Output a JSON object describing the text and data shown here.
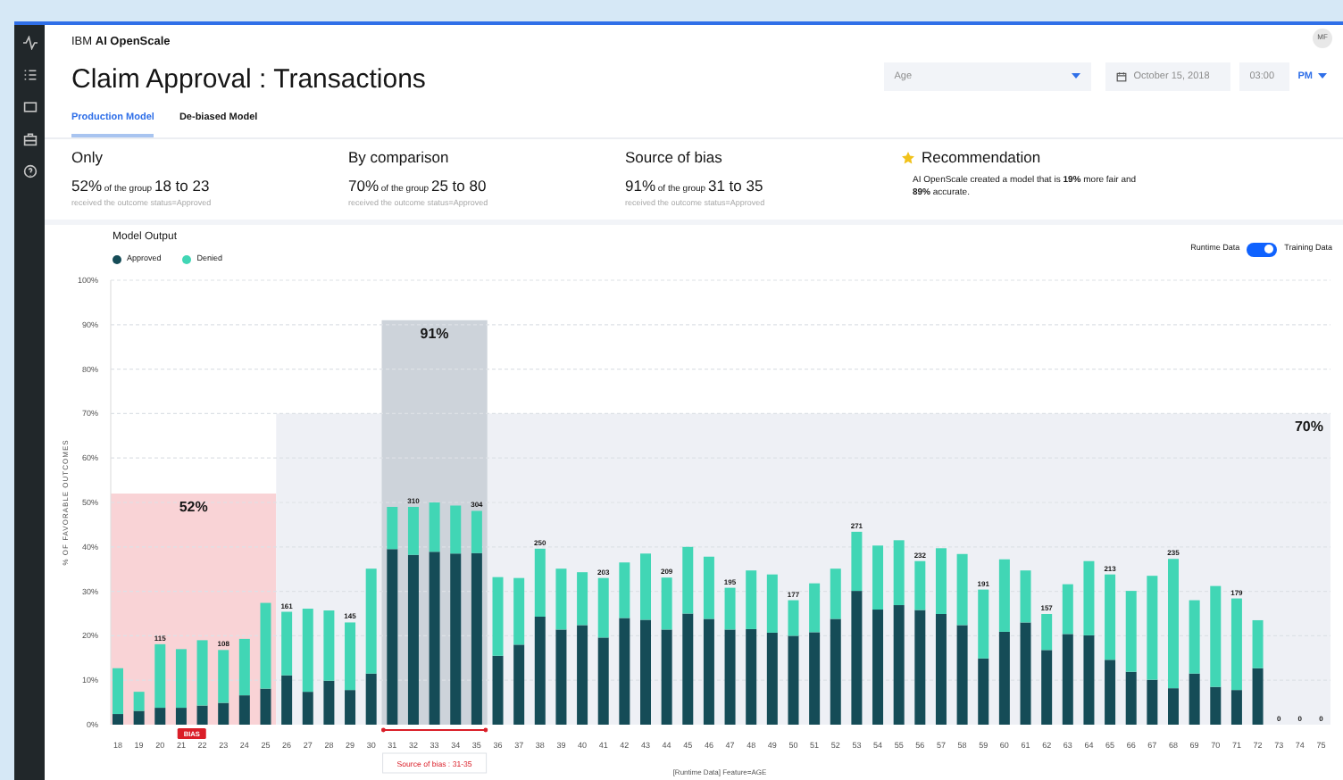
{
  "header": {
    "brand_prefix": "IBM",
    "brand_name": "AI OpenScale",
    "avatar": "MF"
  },
  "page_title": "Claim Approval : Transactions",
  "tabs": [
    {
      "label": "Production Model",
      "selected": true
    },
    {
      "label": "De-biased Model",
      "selected": false
    }
  ],
  "filters": {
    "feature": {
      "value": "Age"
    },
    "date": {
      "value": "October 15, 2018"
    },
    "time": {
      "value": "03:00"
    },
    "period": {
      "value": "PM"
    }
  },
  "summary": [
    {
      "kind": "stat",
      "title": "Only",
      "percent": "52%",
      "connector": "of the group",
      "range": "18 to 23",
      "note": "received the outcome status=Approved"
    },
    {
      "kind": "stat",
      "title": "By comparison",
      "percent": "70%",
      "connector": "of the group",
      "range": "25 to 80",
      "note": "received the outcome status=Approved"
    },
    {
      "kind": "stat",
      "title": "Source of bias",
      "percent": "91%",
      "connector": "of the group",
      "range": "31 to 35",
      "note": "received the outcome status=Approved"
    },
    {
      "kind": "recommendation",
      "title": "Recommendation",
      "text": "AI OpenScale created a model that is **19%** more fair and **89%** accurate."
    }
  ],
  "chart": {
    "title": "Model Output",
    "toggle": {
      "left_label": "Runtime Data",
      "right_label": "Training Data",
      "on": true
    },
    "highlights": [
      {
        "kind": "monitored",
        "label": "52%",
        "color": "#f9d3d6"
      },
      {
        "kind": "source",
        "label": "91%",
        "color": "#cdd3da"
      },
      {
        "kind": "reference",
        "label": "70%",
        "color": "#eef0f5"
      }
    ],
    "bias_tag": {
      "label": "BIAS"
    },
    "bias_callout": {
      "label": "Source of bias : 31-35"
    },
    "chart_data": {
      "type": "bar",
      "stacked": true,
      "grid": true,
      "xlabel": "[Runtime Data] Feature=AGE",
      "ylabel": "% OF FAVORABLE OUTCOMES",
      "categories": [
        "18",
        "19",
        "20",
        "21",
        "22",
        "23",
        "24",
        "25",
        "26",
        "27",
        "28",
        "29",
        "30",
        "31",
        "32",
        "33",
        "34",
        "35",
        "36",
        "37",
        "38",
        "39",
        "40",
        "41",
        "42",
        "43",
        "44",
        "45",
        "46",
        "47",
        "48",
        "49",
        "50",
        "51",
        "52",
        "53",
        "54",
        "55",
        "56",
        "57",
        "58",
        "59",
        "60",
        "61",
        "62",
        "63",
        "64",
        "65",
        "66",
        "67",
        "68",
        "69",
        "70",
        "71",
        "72",
        "73",
        "74",
        "75"
      ],
      "ylim": [
        0,
        100
      ],
      "yticks": [
        {
          "value": 0,
          "label": "0%"
        },
        {
          "value": 10,
          "label": "10%"
        },
        {
          "value": 20,
          "label": "20%"
        },
        {
          "value": 30,
          "label": "30%"
        },
        {
          "value": 40,
          "label": "40%"
        },
        {
          "value": 50,
          "label": "50%"
        },
        {
          "value": 60,
          "label": "60%"
        },
        {
          "value": 70,
          "label": "70%"
        },
        {
          "value": 80,
          "label": "80%"
        },
        {
          "value": 90,
          "label": "90%"
        },
        {
          "value": 100,
          "label": "100%"
        }
      ],
      "series": [
        {
          "name": "Approved",
          "color": "#154c57",
          "values": [
            2.4,
            3.1,
            3.8,
            3.8,
            4.3,
            4.9,
            6.6,
            8.1,
            11.1,
            7.4,
            9.9,
            7.8,
            11.5,
            39.5,
            38.2,
            38.9,
            38.5,
            38.6,
            15.5,
            18,
            24.3,
            21.4,
            22.4,
            19.6,
            24,
            23.6,
            21.4,
            25,
            23.8,
            21.4,
            21.5,
            20.7,
            20,
            20.8,
            23.8,
            30.1,
            25.9,
            26.9,
            25.8,
            24.9,
            22.4,
            14.9,
            20.9,
            23,
            16.8,
            20.4,
            20.1,
            14.6,
            11.9,
            10.1,
            8.2,
            11.5,
            8.5,
            7.8,
            12.7,
            0,
            0,
            0
          ]
        },
        {
          "name": "Denied",
          "color": "#41d6b5",
          "values": [
            10.3,
            4.3,
            14.3,
            13.2,
            14.7,
            11.9,
            12.7,
            19.3,
            14.3,
            18.7,
            15.8,
            15.2,
            23.6,
            9.5,
            10.8,
            11.1,
            10.8,
            9.5,
            17.7,
            15,
            15.3,
            13.7,
            11.9,
            13.4,
            12.5,
            14.9,
            11.7,
            15,
            14,
            9.4,
            13.2,
            13.1,
            8,
            11,
            11.3,
            13.3,
            14.4,
            14.6,
            11,
            14.8,
            16,
            15.5,
            16.3,
            11.7,
            8.1,
            11.2,
            16.7,
            19.2,
            18.2,
            23.4,
            29.1,
            16.5,
            22.7,
            20.6,
            10.8,
            0,
            0,
            0
          ]
        }
      ],
      "value_labels": [
        null,
        null,
        "115",
        null,
        null,
        "108",
        null,
        null,
        "161",
        null,
        null,
        "145",
        null,
        null,
        "310",
        null,
        null,
        "304",
        null,
        null,
        "250",
        null,
        null,
        "203",
        null,
        null,
        "209",
        null,
        null,
        "195",
        null,
        null,
        "177",
        null,
        null,
        "271",
        null,
        null,
        "232",
        null,
        null,
        "191",
        null,
        null,
        "157",
        null,
        null,
        "213",
        null,
        null,
        "235",
        null,
        null,
        "179",
        null,
        "0",
        "0",
        "0"
      ]
    }
  }
}
